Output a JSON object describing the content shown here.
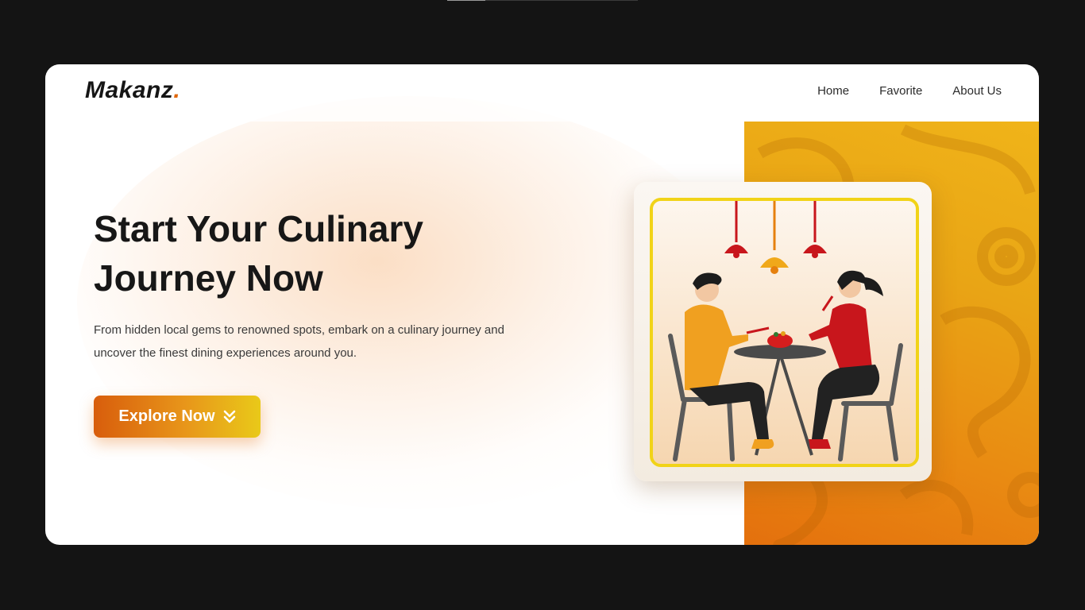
{
  "brand": {
    "name": "Makanz",
    "dot": "."
  },
  "nav": {
    "items": [
      {
        "label": "Home"
      },
      {
        "label": "Favorite"
      },
      {
        "label": "About Us"
      }
    ]
  },
  "hero": {
    "title_line1": "Start Your Culinary",
    "title_line2": "Journey Now",
    "description": "From hidden local gems to renowned spots, embark on a culinary journey and uncover the finest dining experiences around you.",
    "cta_label": "Explore Now"
  },
  "icons": {
    "cta": "double-chevron-down-icon",
    "illustration": "couple-dining-illustration"
  },
  "colors": {
    "accent": "#e0670a",
    "panel_top": "#f0b419",
    "panel_bottom": "#e4700d",
    "frame": "#f1d318",
    "text": "#171717"
  }
}
